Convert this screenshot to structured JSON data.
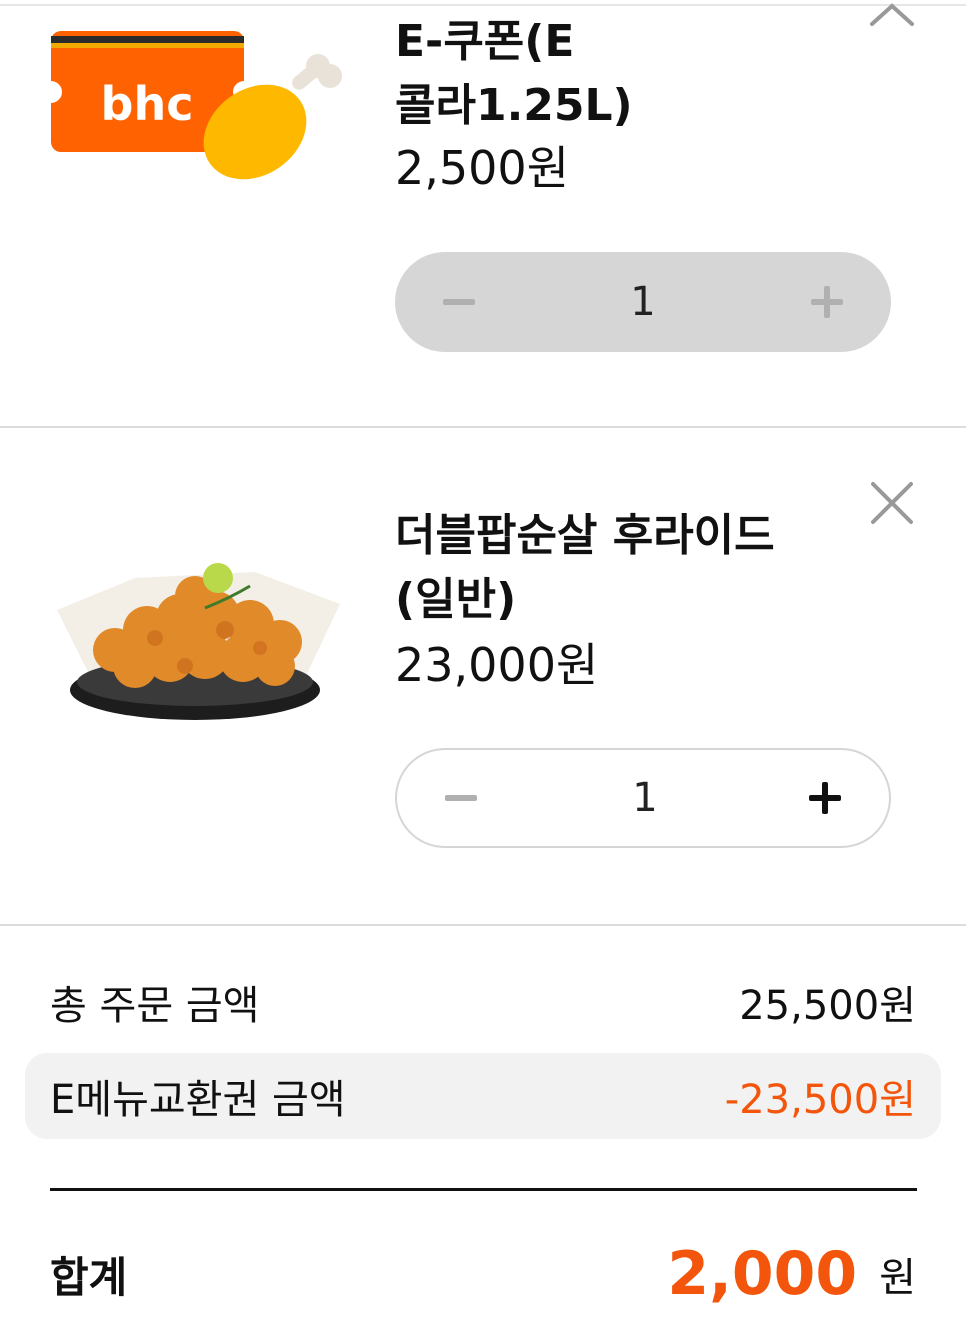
{
  "items": [
    {
      "name": "E-쿠폰(E\n콜라1.25L)",
      "price": "2,500원",
      "quantity": "1",
      "thumbnail_icon": "bhc-coupon-icon",
      "thumbnail_text": "bhc"
    },
    {
      "name": "더블팝순살 후라이드\n(일반)",
      "price": "23,000원",
      "quantity": "1",
      "thumbnail_icon": "chicken-basket-image"
    }
  ],
  "summary": {
    "order_total_label": "총 주문 금액",
    "order_total_value": "25,500원",
    "discount_label": "E메뉴교환권 금액",
    "discount_value": "-23,500원",
    "total_label": "합계",
    "total_value": "2,000",
    "total_unit": "원"
  },
  "colors": {
    "accent": "#f2550b",
    "brand_orange": "#ff6200",
    "disabled_stepper": "#d6d6d6"
  }
}
